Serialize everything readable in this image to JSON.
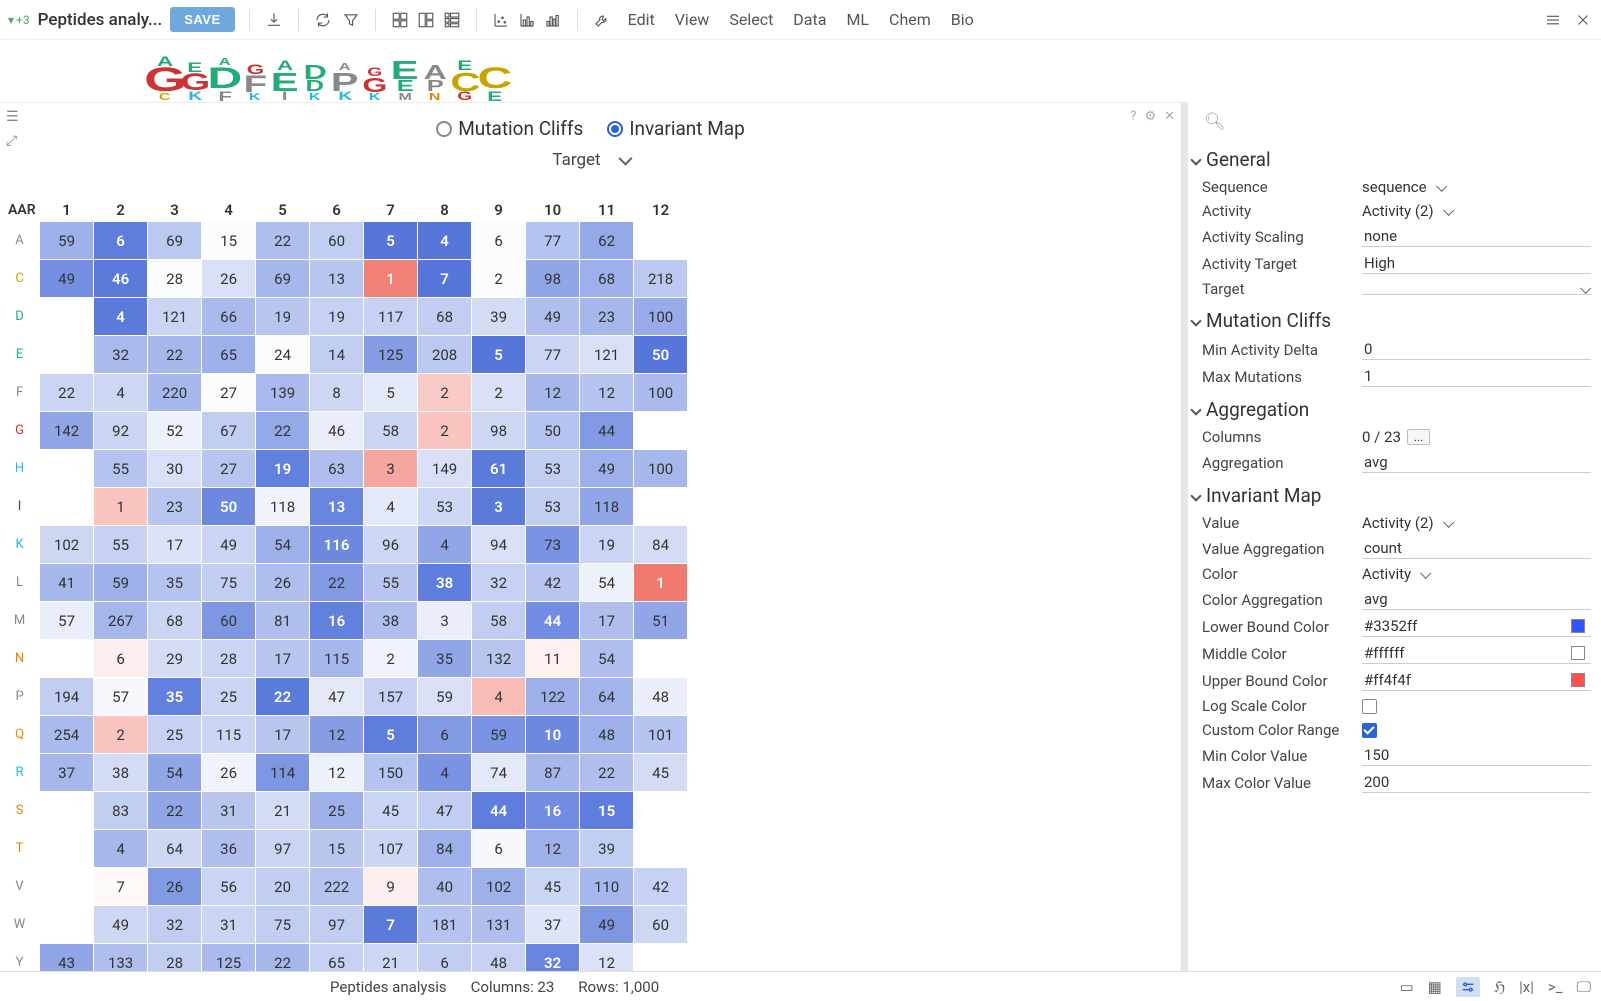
{
  "toolbar": {
    "plus_count": "+3",
    "title": "Peptides analy...",
    "save": "SAVE",
    "menus": [
      "Edit",
      "View",
      "Select",
      "Data",
      "ML",
      "Chem",
      "Bio"
    ]
  },
  "mode": {
    "opt1": "Mutation Cliffs",
    "opt2": "Invariant Map",
    "target_label": "Target"
  },
  "heatmap": {
    "corner": "AAR",
    "cols": [
      "1",
      "2",
      "3",
      "4",
      "5",
      "6",
      "7",
      "8",
      "9",
      "10",
      "11",
      "12"
    ],
    "rows": [
      {
        "k": "A",
        "c": "#888",
        "cells": [
          [
            "59",
            0.55
          ],
          [
            "6",
            0.9
          ],
          [
            "69",
            0.38
          ],
          [
            "15",
            0.02
          ],
          [
            "22",
            0.45
          ],
          [
            "60",
            0.35
          ],
          [
            "5",
            0.95
          ],
          [
            "4",
            0.95
          ],
          [
            "6",
            0.02
          ],
          [
            "77",
            0.42
          ],
          [
            "62",
            0.6
          ],
          [
            "",
            null
          ]
        ]
      },
      {
        "k": "C",
        "c": "#c9a400",
        "cells": [
          [
            "49",
            0.78
          ],
          [
            "46",
            0.92
          ],
          [
            "28",
            0.02
          ],
          [
            "26",
            0.22
          ],
          [
            "69",
            0.5
          ],
          [
            "13",
            0.4
          ],
          [
            "1",
            -0.85
          ],
          [
            "7",
            0.95
          ],
          [
            "2",
            0.02
          ],
          [
            "98",
            0.62
          ],
          [
            "68",
            0.55
          ],
          [
            "218",
            0.38
          ]
        ]
      },
      {
        "k": "D",
        "c": "#2a7",
        "cells": [
          [
            "",
            null
          ],
          [
            "4",
            0.92
          ],
          [
            "121",
            0.3
          ],
          [
            "66",
            0.48
          ],
          [
            "19",
            0.4
          ],
          [
            "19",
            0.32
          ],
          [
            "117",
            0.32
          ],
          [
            "68",
            0.35
          ],
          [
            "39",
            0.25
          ],
          [
            "49",
            0.45
          ],
          [
            "23",
            0.5
          ],
          [
            "100",
            0.58
          ]
        ]
      },
      {
        "k": "E",
        "c": "#2a7",
        "cells": [
          [
            "",
            null
          ],
          [
            "32",
            0.48
          ],
          [
            "22",
            0.5
          ],
          [
            "65",
            0.55
          ],
          [
            "24",
            0.02
          ],
          [
            "14",
            0.35
          ],
          [
            "125",
            0.68
          ],
          [
            "208",
            0.38
          ],
          [
            "5",
            0.95
          ],
          [
            "77",
            0.3
          ],
          [
            "121",
            0.22
          ],
          [
            "50",
            0.95
          ]
        ]
      },
      {
        "k": "F",
        "c": "#888",
        "cells": [
          [
            "22",
            0.3
          ],
          [
            "4",
            0.28
          ],
          [
            "220",
            0.5
          ],
          [
            "27",
            0.02
          ],
          [
            "139",
            0.48
          ],
          [
            "8",
            0.28
          ],
          [
            "5",
            0.15
          ],
          [
            "2",
            -0.35
          ],
          [
            "2",
            0.22
          ],
          [
            "12",
            0.5
          ],
          [
            "12",
            0.42
          ],
          [
            "100",
            0.48
          ]
        ]
      },
      {
        "k": "G",
        "c": "#c33",
        "cells": [
          [
            "142",
            0.62
          ],
          [
            "92",
            0.3
          ],
          [
            "52",
            0.1
          ],
          [
            "67",
            0.35
          ],
          [
            "22",
            0.6
          ],
          [
            "46",
            0.12
          ],
          [
            "58",
            0.3
          ],
          [
            "2",
            -0.4
          ],
          [
            "98",
            0.28
          ],
          [
            "50",
            0.42
          ],
          [
            "44",
            0.7
          ],
          [
            "",
            null
          ]
        ]
      },
      {
        "k": "H",
        "c": "#2bd",
        "cells": [
          [
            "",
            null
          ],
          [
            "55",
            0.42
          ],
          [
            "30",
            0.22
          ],
          [
            "27",
            0.4
          ],
          [
            "19",
            0.88
          ],
          [
            "63",
            0.45
          ],
          [
            "3",
            -0.6
          ],
          [
            "149",
            0.22
          ],
          [
            "61",
            0.92
          ],
          [
            "53",
            0.35
          ],
          [
            "49",
            0.55
          ],
          [
            "100",
            0.5
          ]
        ]
      },
      {
        "k": "I",
        "c": "#444",
        "cells": [
          [
            "",
            null
          ],
          [
            "1",
            -0.4
          ],
          [
            "23",
            0.4
          ],
          [
            "50",
            0.82
          ],
          [
            "118",
            0.08
          ],
          [
            "13",
            0.85
          ],
          [
            "4",
            0.15
          ],
          [
            "53",
            0.28
          ],
          [
            "3",
            0.92
          ],
          [
            "53",
            0.35
          ],
          [
            "118",
            0.62
          ],
          [
            "",
            null
          ]
        ]
      },
      {
        "k": "K",
        "c": "#2bd",
        "cells": [
          [
            "102",
            0.28
          ],
          [
            "55",
            0.32
          ],
          [
            "17",
            0.2
          ],
          [
            "49",
            0.3
          ],
          [
            "54",
            0.55
          ],
          [
            "116",
            0.82
          ],
          [
            "96",
            0.28
          ],
          [
            "4",
            0.62
          ],
          [
            "94",
            0.22
          ],
          [
            "73",
            0.75
          ],
          [
            "19",
            0.3
          ],
          [
            "84",
            0.25
          ]
        ]
      },
      {
        "k": "L",
        "c": "#888",
        "cells": [
          [
            "41",
            0.5
          ],
          [
            "59",
            0.55
          ],
          [
            "35",
            0.42
          ],
          [
            "75",
            0.35
          ],
          [
            "26",
            0.45
          ],
          [
            "22",
            0.7
          ],
          [
            "55",
            0.4
          ],
          [
            "38",
            0.9
          ],
          [
            "32",
            0.32
          ],
          [
            "42",
            0.4
          ],
          [
            "54",
            0.1
          ],
          [
            "1",
            -0.9
          ]
        ]
      },
      {
        "k": "M",
        "c": "#888",
        "cells": [
          [
            "57",
            0.12
          ],
          [
            "267",
            0.5
          ],
          [
            "68",
            0.3
          ],
          [
            "60",
            0.72
          ],
          [
            "81",
            0.45
          ],
          [
            "16",
            0.88
          ],
          [
            "38",
            0.45
          ],
          [
            "3",
            0.12
          ],
          [
            "58",
            0.35
          ],
          [
            "44",
            0.8
          ],
          [
            "17",
            0.45
          ],
          [
            "51",
            0.62
          ]
        ]
      },
      {
        "k": "N",
        "c": "#d80",
        "cells": [
          [
            "",
            null
          ],
          [
            "6",
            -0.12
          ],
          [
            "29",
            0.25
          ],
          [
            "28",
            0.3
          ],
          [
            "17",
            0.4
          ],
          [
            "115",
            0.5
          ],
          [
            "2",
            0.08
          ],
          [
            "35",
            0.62
          ],
          [
            "132",
            0.4
          ],
          [
            "11",
            -0.1
          ],
          [
            "54",
            0.45
          ],
          [
            "",
            null
          ]
        ]
      },
      {
        "k": "P",
        "c": "#888",
        "cells": [
          [
            "194",
            0.35
          ],
          [
            "57",
            0.05
          ],
          [
            "35",
            0.88
          ],
          [
            "25",
            0.3
          ],
          [
            "22",
            0.92
          ],
          [
            "47",
            0.15
          ],
          [
            "157",
            0.32
          ],
          [
            "59",
            0.22
          ],
          [
            "4",
            -0.45
          ],
          [
            "122",
            0.55
          ],
          [
            "64",
            0.52
          ],
          [
            "48",
            0.12
          ]
        ]
      },
      {
        "k": "Q",
        "c": "#d80",
        "cells": [
          [
            "254",
            0.48
          ],
          [
            "2",
            -0.4
          ],
          [
            "25",
            0.32
          ],
          [
            "115",
            0.3
          ],
          [
            "17",
            0.4
          ],
          [
            "12",
            0.68
          ],
          [
            "5",
            0.9
          ],
          [
            "6",
            0.7
          ],
          [
            "59",
            0.75
          ],
          [
            "10",
            0.82
          ],
          [
            "48",
            0.55
          ],
          [
            "101",
            0.42
          ]
        ]
      },
      {
        "k": "R",
        "c": "#2bd",
        "cells": [
          [
            "37",
            0.5
          ],
          [
            "38",
            0.25
          ],
          [
            "54",
            0.62
          ],
          [
            "26",
            0.08
          ],
          [
            "114",
            0.72
          ],
          [
            "12",
            0.1
          ],
          [
            "150",
            0.42
          ],
          [
            "4",
            0.75
          ],
          [
            "74",
            0.15
          ],
          [
            "87",
            0.5
          ],
          [
            "22",
            0.45
          ],
          [
            "45",
            0.25
          ]
        ]
      },
      {
        "k": "S",
        "c": "#d80",
        "cells": [
          [
            "",
            null
          ],
          [
            "83",
            0.35
          ],
          [
            "22",
            0.62
          ],
          [
            "31",
            0.4
          ],
          [
            "21",
            0.25
          ],
          [
            "25",
            0.55
          ],
          [
            "45",
            0.3
          ],
          [
            "47",
            0.35
          ],
          [
            "44",
            0.9
          ],
          [
            "16",
            0.8
          ],
          [
            "15",
            0.9
          ],
          [
            "",
            null
          ]
        ]
      },
      {
        "k": "T",
        "c": "#d80",
        "cells": [
          [
            "",
            null
          ],
          [
            "4",
            0.5
          ],
          [
            "64",
            0.28
          ],
          [
            "36",
            0.45
          ],
          [
            "97",
            0.3
          ],
          [
            "15",
            0.4
          ],
          [
            "107",
            0.3
          ],
          [
            "84",
            0.55
          ],
          [
            "6",
            0.05
          ],
          [
            "12",
            0.55
          ],
          [
            "39",
            0.35
          ],
          [
            "",
            null
          ]
        ]
      },
      {
        "k": "V",
        "c": "#888",
        "cells": [
          [
            "",
            null
          ],
          [
            "7",
            -0.05
          ],
          [
            "26",
            0.7
          ],
          [
            "56",
            0.3
          ],
          [
            "20",
            0.35
          ],
          [
            "222",
            0.42
          ],
          [
            "9",
            -0.12
          ],
          [
            "40",
            0.45
          ],
          [
            "102",
            0.55
          ],
          [
            "45",
            0.3
          ],
          [
            "110",
            0.5
          ],
          [
            "42",
            0.32
          ]
        ]
      },
      {
        "k": "W",
        "c": "#888",
        "cells": [
          [
            "",
            null
          ],
          [
            "49",
            0.28
          ],
          [
            "32",
            0.35
          ],
          [
            "31",
            0.3
          ],
          [
            "75",
            0.35
          ],
          [
            "97",
            0.35
          ],
          [
            "7",
            0.92
          ],
          [
            "181",
            0.42
          ],
          [
            "131",
            0.45
          ],
          [
            "37",
            0.18
          ],
          [
            "49",
            0.72
          ],
          [
            "60",
            0.28
          ]
        ]
      },
      {
        "k": "Y",
        "c": "#888",
        "cells": [
          [
            "43",
            0.62
          ],
          [
            "133",
            0.45
          ],
          [
            "28",
            0.35
          ],
          [
            "125",
            0.48
          ],
          [
            "22",
            0.5
          ],
          [
            "65",
            0.32
          ],
          [
            "21",
            0.28
          ],
          [
            "6",
            0.35
          ],
          [
            "48",
            0.32
          ],
          [
            "32",
            0.85
          ],
          [
            "12",
            0.2
          ],
          [
            "",
            null
          ]
        ]
      }
    ]
  },
  "statusbar": {
    "name": "Peptides analysis",
    "cols": "Columns: 23",
    "rows": "Rows: 1,000"
  },
  "panel": {
    "general": {
      "title": "General",
      "sequence_l": "Sequence",
      "sequence_v": "sequence",
      "activity_l": "Activity",
      "activity_v": "Activity (2)",
      "scaling_l": "Activity Scaling",
      "scaling_v": "none",
      "target_l": "Activity Target",
      "target_v": "High",
      "tgt_l": "Target",
      "tgt_v": ""
    },
    "cliffs": {
      "title": "Mutation Cliffs",
      "min_l": "Min Activity Delta",
      "min_v": "0",
      "max_l": "Max Mutations",
      "max_v": "1"
    },
    "agg": {
      "title": "Aggregation",
      "cols_l": "Columns",
      "cols_v": "0 / 23",
      "agg_l": "Aggregation",
      "agg_v": "avg"
    },
    "inv": {
      "title": "Invariant Map",
      "val_l": "Value",
      "val_v": "Activity (2)",
      "vagg_l": "Value Aggregation",
      "vagg_v": "count",
      "color_l": "Color",
      "color_v": "Activity",
      "cagg_l": "Color Aggregation",
      "cagg_v": "avg",
      "low_l": "Lower Bound Color",
      "low_v": "#3352ff",
      "low_sw": "#3352ff",
      "mid_l": "Middle Color",
      "mid_v": "#ffffff",
      "mid_sw": "#ffffff",
      "up_l": "Upper Bound Color",
      "up_v": "#ff4f4f",
      "up_sw": "#ff4f4f",
      "log_l": "Log Scale Color",
      "custom_l": "Custom Color Range",
      "mincv_l": "Min Color Value",
      "mincv_v": "150",
      "maxcv_l": "Max Color Value",
      "maxcv_v": "200"
    }
  },
  "colors": {
    "blue": "#4d6fd8",
    "red": "#ef6b5f"
  }
}
